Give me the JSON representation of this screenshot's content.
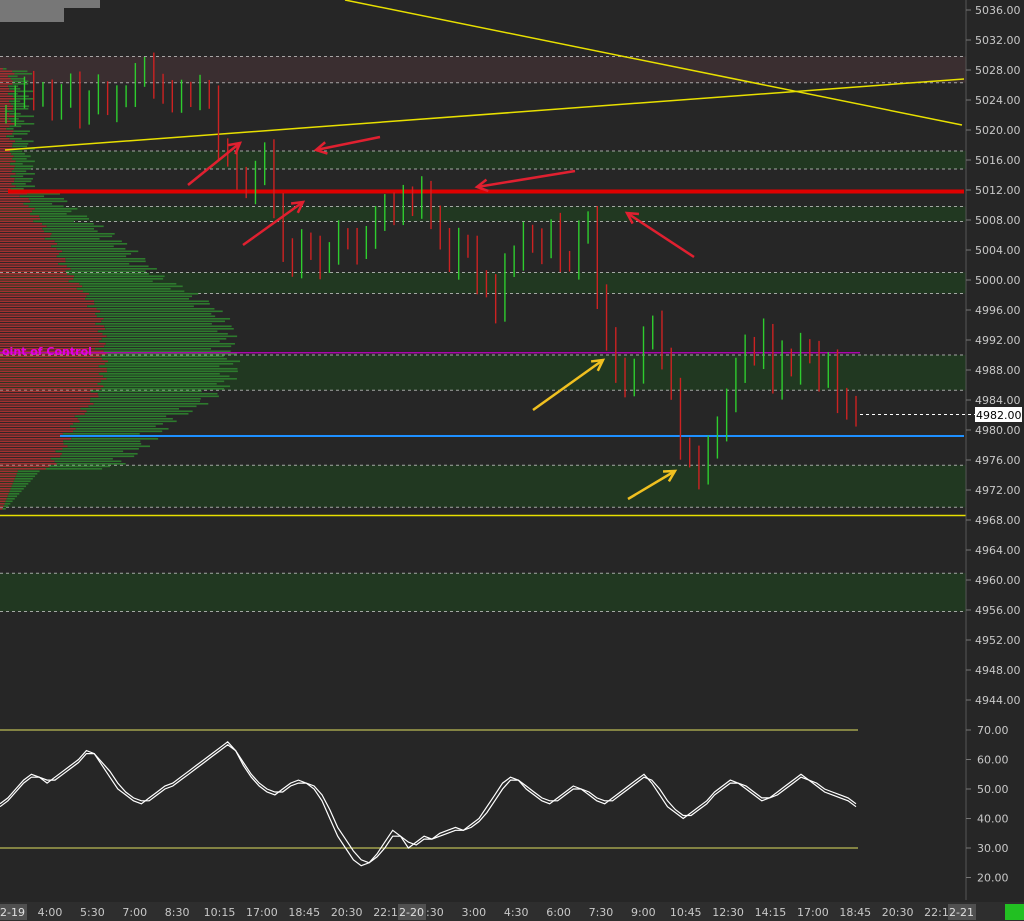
{
  "colors": {
    "background": "#262626",
    "band_fill": "#213821",
    "top_band_fill": "#3a2e30",
    "up_bar": "#2ecc2e",
    "down_bar": "#cc2222",
    "red_level": "#e00000",
    "blue_level": "#1e90ff",
    "yellow": "#e8e000",
    "poc_line": "#c000c0",
    "oscillator": "#ffffff",
    "osc_level": "#e0e060",
    "red_arrow": "#e02030",
    "gold_arrow": "#f0c020",
    "dashed": "#d0d0d0"
  },
  "poc_label": "oint of Control",
  "last_price_label": "4982.00",
  "date_tags": [
    "2-19",
    "2-20",
    "2-21"
  ],
  "chart_data": [
    {
      "type": "ohlc",
      "price_axis": {
        "ylim": [
          4942,
          5038
        ],
        "ticks": [
          "5036.00",
          "5032.00",
          "5028.00",
          "5024.00",
          "5020.00",
          "5016.00",
          "5012.00",
          "5008.00",
          "5004.00",
          "5000.00",
          "4996.00",
          "4992.00",
          "4988.00",
          "4984.00",
          "4980.00",
          "4976.00",
          "4972.00",
          "4968.00",
          "4964.00",
          "4960.00",
          "4956.00",
          "4952.00",
          "4948.00",
          "4944.00"
        ]
      },
      "time_axis": [
        "4:00",
        "5:30",
        "7:00",
        "8:30",
        "10:15",
        "17:00",
        "18:45",
        "20:30",
        "22:15",
        "1:30",
        "3:00",
        "4:30",
        "6:00",
        "7:30",
        "9:00",
        "10:45",
        "12:30",
        "14:15",
        "17:00",
        "18:45",
        "20:30",
        "22:15"
      ],
      "last_price": 4982.0,
      "series": [
        {
          "name": "",
          "close": [
            5022.5,
            5024,
            5026,
            5024.5,
            5025,
            5023,
            5024.5,
            5026,
            5022,
            5024,
            5025.5,
            5023,
            5024,
            5025,
            5027,
            5028.5,
            5026,
            5025,
            5024,
            5025,
            5024.5,
            5025.5,
            5024,
            5018,
            5016,
            5014,
            5012,
            5014,
            5017,
            5010,
            5004,
            5002,
            5005,
            5004,
            5002,
            5004,
            5006,
            5005,
            5004,
            5006,
            5008,
            5010,
            5009,
            5011,
            5010,
            5012,
            5008,
            5006,
            5002,
            5005,
            5004,
            5000,
            4999,
            4996,
            5002,
            5003,
            5006,
            5005,
            5004,
            5007,
            5003,
            5002,
            5006,
            5008,
            4998,
            4992,
            4988,
            4986,
            4988,
            4992,
            4994,
            4990,
            4985,
            4978,
            4976,
            4974,
            4978,
            4980,
            4984,
            4988,
            4991,
            4990,
            4993,
            4986,
            4990,
            4988,
            4991,
            4990,
            4987,
            4989,
            4984,
            4983,
            4982
          ]
        }
      ],
      "levels": [
        {
          "name": "red_level",
          "price": 5011.8
        },
        {
          "name": "blue_level",
          "price": 4979.2
        },
        {
          "name": "poc",
          "price": 4990.3
        },
        {
          "name": "yellow_low",
          "price": 4968.6
        }
      ],
      "dashed_levels": [
        5029.8,
        5026.3,
        5017.2,
        5014.8,
        5009.8,
        5007.8,
        5001.0,
        4998.2,
        4990.0,
        4985.3,
        4975.3,
        4969.7,
        4960.9,
        4955.8
      ],
      "bands": [
        {
          "from": 5026.3,
          "to": 5029.8,
          "kind": "top"
        },
        {
          "from": 5014.8,
          "to": 5017.2,
          "kind": "green"
        },
        {
          "from": 5007.8,
          "to": 5009.8,
          "kind": "green"
        },
        {
          "from": 4998.2,
          "to": 5001.0,
          "kind": "green"
        },
        {
          "from": 4985.3,
          "to": 4990.0,
          "kind": "green"
        },
        {
          "from": 4969.7,
          "to": 4975.3,
          "kind": "green"
        },
        {
          "from": 4955.8,
          "to": 4960.9,
          "kind": "green"
        }
      ]
    },
    {
      "type": "line",
      "ylim": [
        15,
        75
      ],
      "ticks": [
        "70.00",
        "60.00",
        "50.00",
        "40.00",
        "30.00",
        "20.00"
      ],
      "levels": [
        70,
        30
      ],
      "series": [
        {
          "name": "",
          "values": [
            45,
            47,
            50,
            53,
            55,
            54,
            52,
            54,
            56,
            58,
            60,
            63,
            62,
            58,
            54,
            50,
            48,
            46,
            45,
            47,
            49,
            51,
            52,
            54,
            56,
            58,
            60,
            62,
            64,
            66,
            63,
            58,
            54,
            51,
            49,
            48,
            50,
            52,
            53,
            52,
            50,
            46,
            40,
            34,
            30,
            26,
            24,
            25,
            28,
            32,
            36,
            34,
            30,
            32,
            34,
            33,
            35,
            36,
            37,
            36,
            38,
            40,
            44,
            48,
            52,
            54,
            53,
            50,
            48,
            46,
            45,
            47,
            49,
            51,
            50,
            48,
            46,
            45,
            47,
            49,
            51,
            53,
            55,
            52,
            48,
            44,
            42,
            40,
            42,
            44,
            46,
            49,
            51,
            53,
            52,
            50,
            48,
            46,
            47,
            49,
            51,
            53,
            55,
            53,
            51,
            49,
            48,
            47,
            46,
            44
          ]
        },
        {
          "name": "",
          "values": [
            44,
            46,
            49,
            52,
            54,
            54,
            53,
            53,
            55,
            57,
            59,
            62,
            62,
            59,
            56,
            52,
            49,
            47,
            46,
            46,
            48,
            50,
            51,
            53,
            55,
            57,
            59,
            61,
            63,
            65,
            63,
            59,
            55,
            52,
            50,
            49,
            49,
            51,
            52,
            52,
            51,
            48,
            43,
            37,
            33,
            29,
            26,
            25,
            27,
            30,
            34,
            34,
            32,
            31,
            33,
            33,
            34,
            35,
            36,
            36,
            37,
            39,
            42,
            46,
            50,
            53,
            53,
            51,
            49,
            47,
            46,
            46,
            48,
            50,
            50,
            49,
            47,
            46,
            46,
            48,
            50,
            52,
            54,
            53,
            50,
            46,
            43,
            41,
            41,
            43,
            45,
            48,
            50,
            52,
            52,
            51,
            49,
            47,
            47,
            48,
            50,
            52,
            54,
            53,
            52,
            50,
            49,
            48,
            47,
            45
          ]
        }
      ]
    }
  ]
}
